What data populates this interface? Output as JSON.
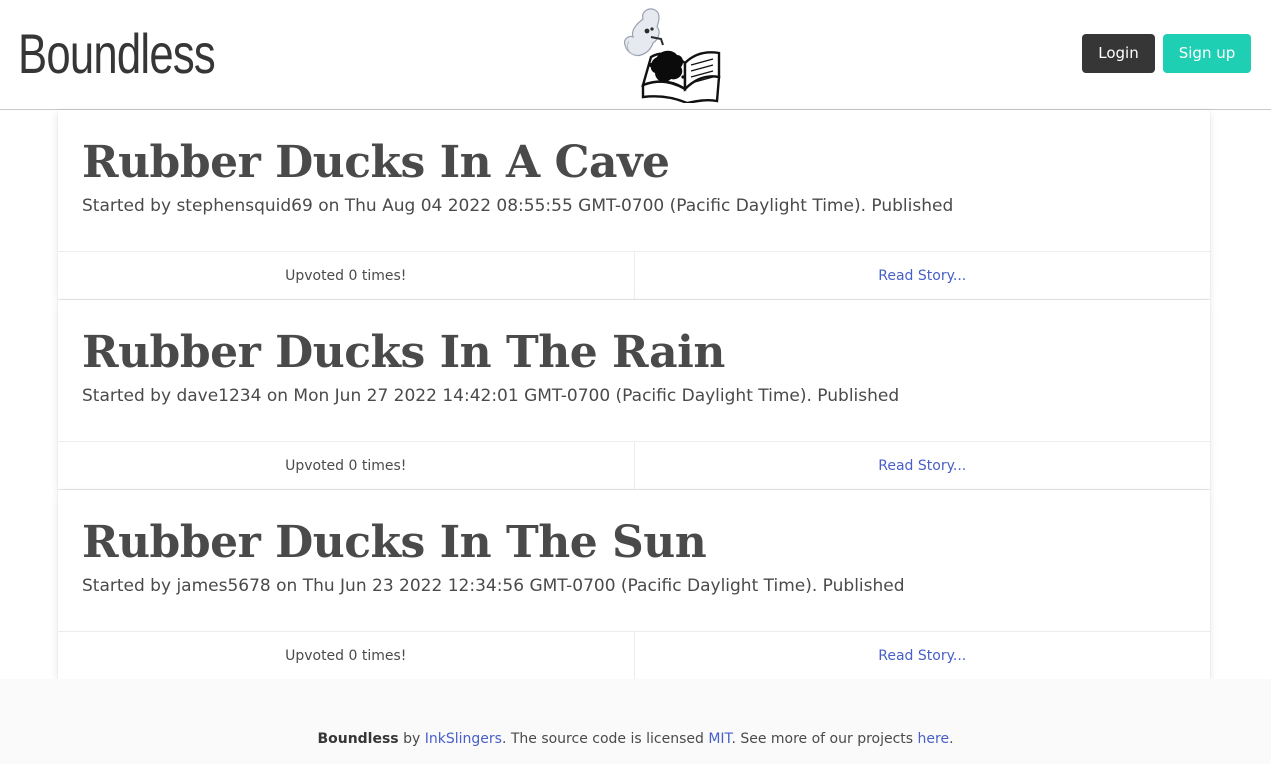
{
  "header": {
    "brand": "Boundless",
    "logo_icon": "ghost-reading-book-icon",
    "login_label": "Login",
    "signup_label": "Sign up"
  },
  "stories": [
    {
      "title": "Rubber Ducks In A Cave",
      "meta": "Started by stephensquid69 on Thu Aug 04 2022 08:55:55 GMT-0700 (Pacific Daylight Time). Published",
      "upvotes": "Upvoted 0 times!",
      "read_link": "Read Story..."
    },
    {
      "title": "Rubber Ducks In The Rain",
      "meta": "Started by dave1234 on Mon Jun 27 2022 14:42:01 GMT-0700 (Pacific Daylight Time). Published",
      "upvotes": "Upvoted 0 times!",
      "read_link": "Read Story..."
    },
    {
      "title": "Rubber Ducks In The Sun",
      "meta": "Started by james5678 on Thu Jun 23 2022 12:34:56 GMT-0700 (Pacific Daylight Time). Published",
      "upvotes": "Upvoted 0 times!",
      "read_link": "Read Story..."
    }
  ],
  "footer": {
    "brand": "Boundless",
    "by": " by ",
    "author_link": "InkSlingers",
    "text_license": ". The source code is licensed ",
    "license_link": "MIT",
    "text_more": ". See more of our projects ",
    "projects_link": "here",
    "text_end": "."
  },
  "colors": {
    "accent": "#1fcfb4",
    "dark": "#363636",
    "link": "#485fc7"
  }
}
